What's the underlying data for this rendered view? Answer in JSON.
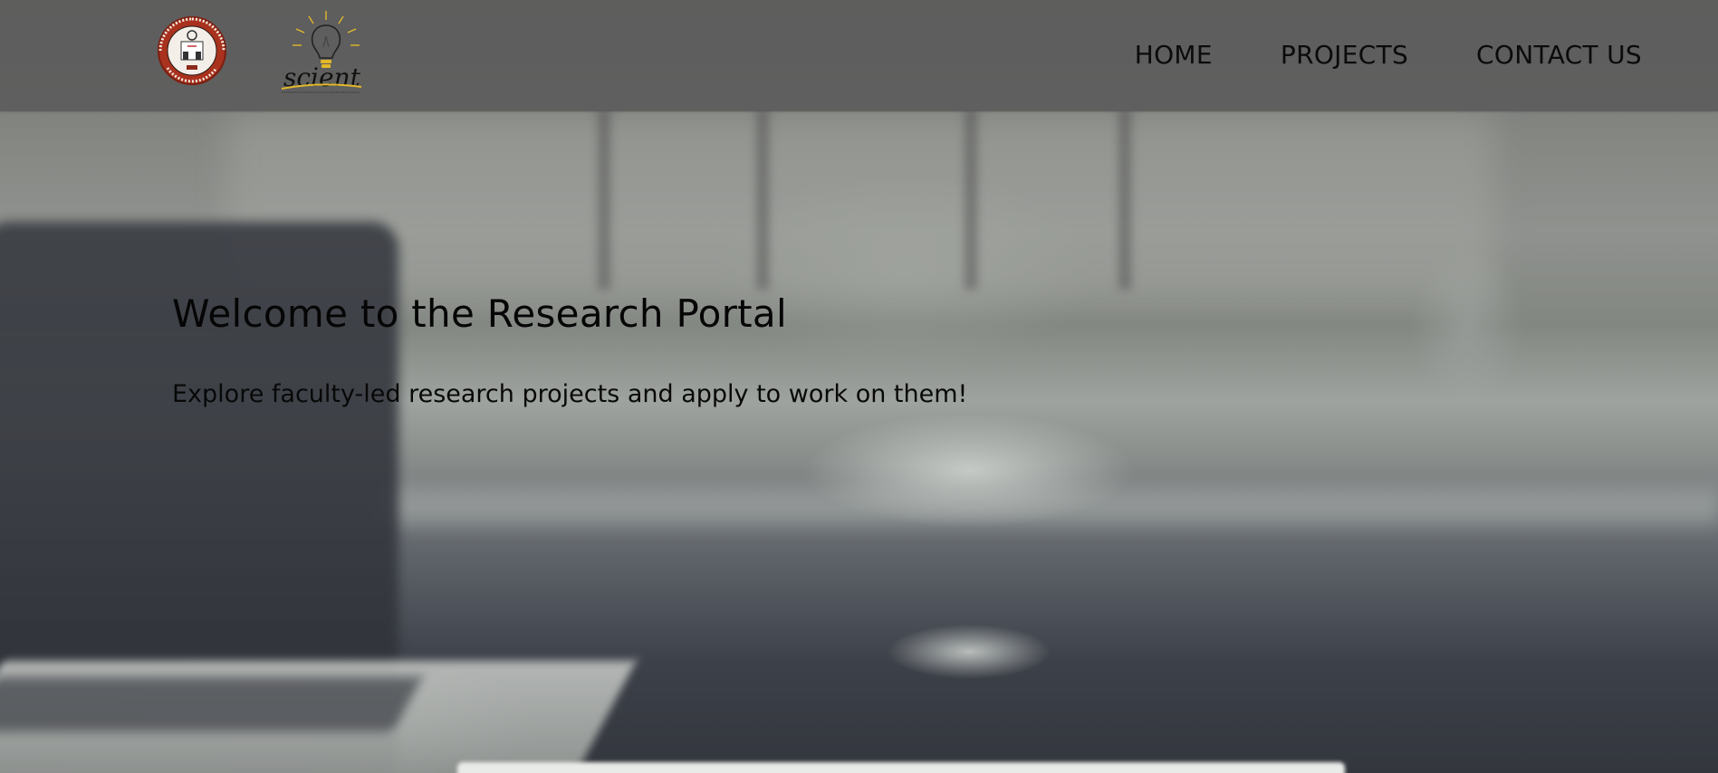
{
  "header": {
    "logos": {
      "institute_logo_icon": "nit-seal-icon",
      "scient_logo_icon": "scient-bulb-logo-icon",
      "scient_wordmark": "scient"
    },
    "nav": {
      "home": "HOME",
      "projects": "PROJECTS",
      "contact": "CONTACT US"
    }
  },
  "hero": {
    "title": "Welcome to the Research Portal",
    "subtitle": "Explore faculty-led research projects and apply to work on them!"
  },
  "colors": {
    "header_bg": "#5c5c5c",
    "text": "#050505",
    "seal_red": "#a8321e",
    "bulb_yellow": "#e2b82a"
  }
}
